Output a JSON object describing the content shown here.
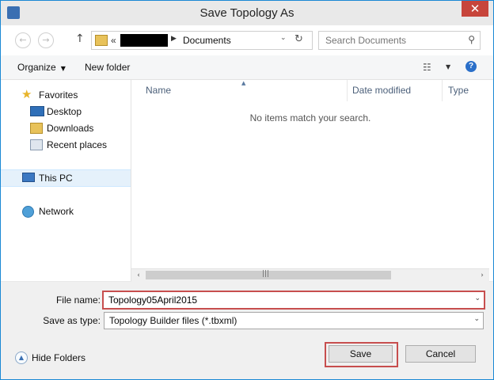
{
  "window": {
    "title": "Save Topology As",
    "close_glyph": "✕"
  },
  "address_bar": {
    "back_glyph": "←",
    "forward_glyph": "→",
    "up_glyph": "↑",
    "overflow": "«",
    "separator": "▶",
    "path_label": "Documents",
    "dropdown_glyph": "⌄",
    "refresh_glyph": "↻",
    "search_placeholder": "Search Documents",
    "search_glyph": "⚲"
  },
  "toolbar": {
    "organize_label": "Organize",
    "new_folder_label": "New folder",
    "caret": "▼",
    "view_glyph": "☷",
    "help_glyph": "?"
  },
  "nav_pane": {
    "favorites": "Favorites",
    "desktop": "Desktop",
    "downloads": "Downloads",
    "recent_places": "Recent places",
    "this_pc": "This PC",
    "network": "Network"
  },
  "file_list": {
    "columns": [
      "Name",
      "Date modified",
      "Type"
    ],
    "sort_glyph": "▲",
    "empty_message": "No items match your search."
  },
  "scrollbar": {
    "left_glyph": "‹",
    "right_glyph": "›",
    "grip_glyph": "|||"
  },
  "form": {
    "file_name_label": "File name:",
    "file_name_value": "Topology05April2015",
    "save_as_type_label": "Save as type:",
    "save_as_type_value": "Topology Builder files (*.tbxml)",
    "dropdown_glyph": "⌄"
  },
  "footer": {
    "hide_folders_label": "Hide Folders",
    "hide_glyph": "▲",
    "save_label": "Save",
    "cancel_label": "Cancel"
  },
  "colors": {
    "highlight": "#c74e4e",
    "accent": "#1a88d4",
    "close": "#c7453b"
  }
}
